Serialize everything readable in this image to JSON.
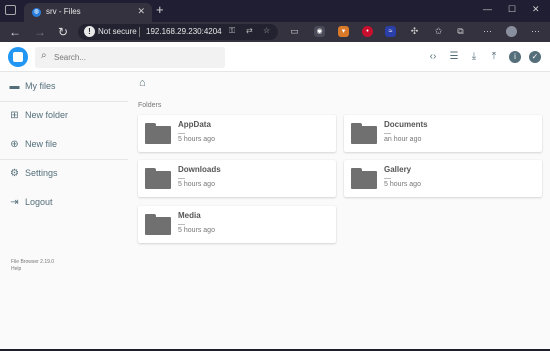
{
  "browser": {
    "tab_title": "srv - Files",
    "tab_favicon": "globe-icon",
    "address": {
      "security_label": "Not secure",
      "url": "192.168.29.230:4204"
    },
    "extensions": [
      {
        "name": "shield-icon",
        "color": "#4a4a58"
      },
      {
        "name": "cup-icon",
        "color": "#d97a2b"
      },
      {
        "name": "lastpass-icon",
        "color": "#c8102e"
      },
      {
        "name": "pattern-icon",
        "color": "#2a3fa8"
      },
      {
        "name": "puzzle-icon",
        "color": "#4a4a58"
      }
    ]
  },
  "app": {
    "search_placeholder": "Search...",
    "header_actions": [
      "code-icon",
      "list-view-icon",
      "download-icon",
      "upload-icon",
      "info-icon",
      "check-icon"
    ],
    "sidebar": {
      "items": [
        {
          "label": "My files",
          "icon": "folder-icon"
        },
        {
          "label": "New folder",
          "icon": "folder-plus-icon"
        },
        {
          "label": "New file",
          "icon": "file-plus-icon"
        },
        {
          "label": "Settings",
          "icon": "settings-icon"
        },
        {
          "label": "Logout",
          "icon": "logout-icon"
        }
      ],
      "credits": {
        "version": "File Browser 2.19.0",
        "help": "Help"
      }
    },
    "main": {
      "section_title": "Folders",
      "folders": [
        {
          "name": "AppData",
          "size": "—",
          "modified": "5 hours ago"
        },
        {
          "name": "Documents",
          "size": "—",
          "modified": "an hour ago"
        },
        {
          "name": "Downloads",
          "size": "—",
          "modified": "5 hours ago"
        },
        {
          "name": "Gallery",
          "size": "—",
          "modified": "5 hours ago"
        },
        {
          "name": "Media",
          "size": "—",
          "modified": "5 hours ago"
        }
      ]
    }
  },
  "colors": {
    "accent": "#2196f3",
    "sidebar_text": "#546e7a",
    "folder": "#707070"
  }
}
